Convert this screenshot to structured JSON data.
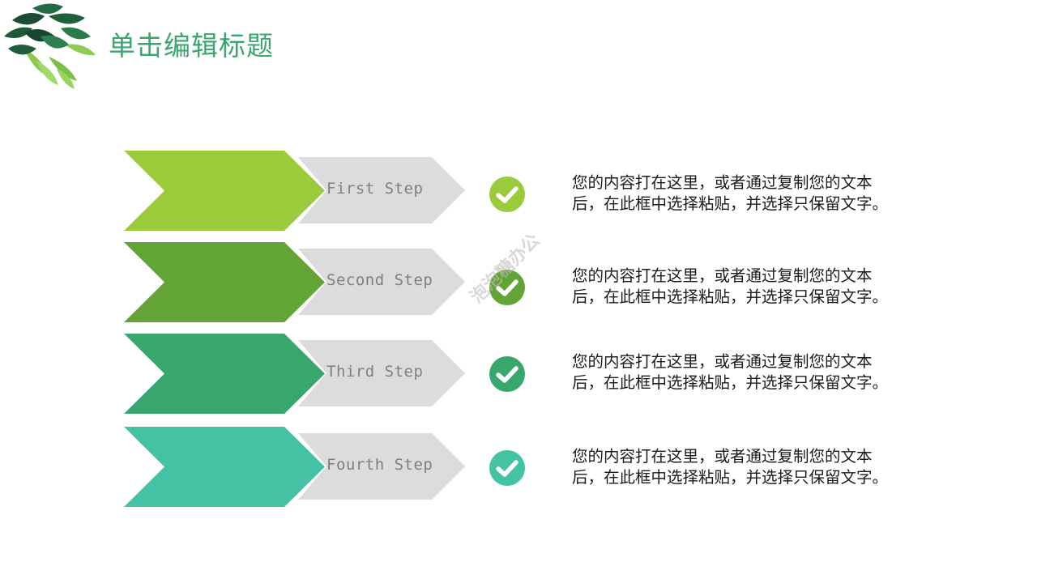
{
  "slide": {
    "title": "单击编辑标题",
    "title_color": "#3aa56e",
    "decoration": "leaves-icon"
  },
  "steps": [
    {
      "label": "First Step",
      "color": "#9bca3a",
      "icon": "check-circle-icon",
      "description_line1": "您的内容打在这里，或者通过复制您的文本",
      "description_line2": "后，在此框中选择粘贴，并选择只保留文字。"
    },
    {
      "label": "Second Step",
      "color": "#62a536",
      "icon": "check-circle-icon",
      "description_line1": "您的内容打在这里，或者通过复制您的文本",
      "description_line2": "后，在此框中选择粘贴，并选择只保留文字。"
    },
    {
      "label": "Third Step",
      "color": "#37a76e",
      "icon": "check-circle-icon",
      "description_line1": "您的内容打在这里，或者通过复制您的文本",
      "description_line2": "后，在此框中选择粘贴，并选择只保留文字。"
    },
    {
      "label": "Fourth Step",
      "color": "#44c2a3",
      "icon": "check-circle-icon",
      "description_line1": "您的内容打在这里，或者通过复制您的文本",
      "description_line2": "后，在此框中选择粘贴，并选择只保留文字。"
    }
  ],
  "gray_chevron_color": "#dcdcdc",
  "watermark": "泡泡糖办公"
}
